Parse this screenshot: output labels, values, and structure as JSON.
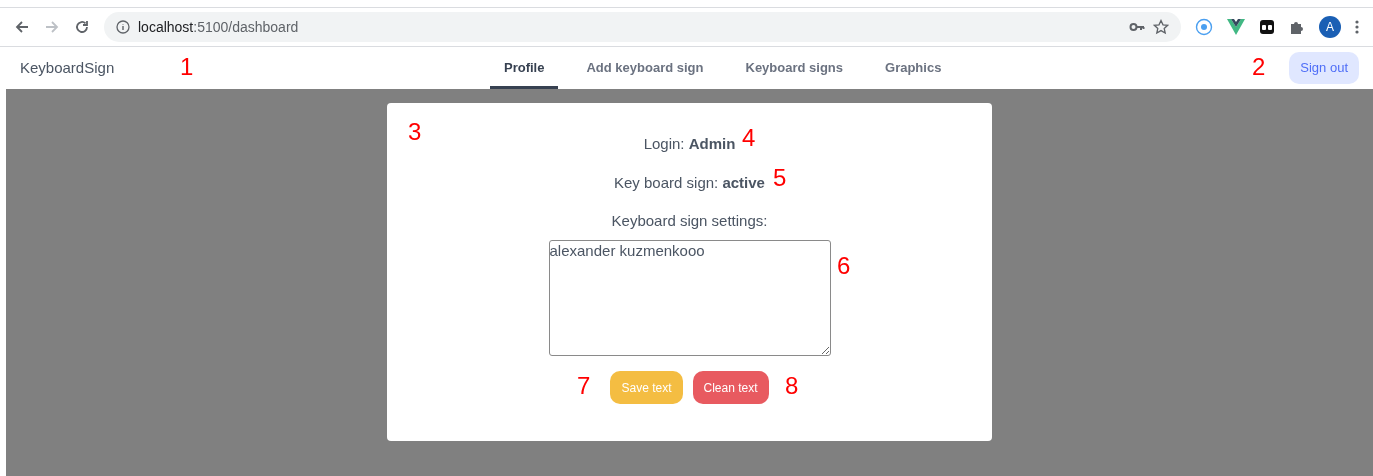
{
  "browser": {
    "url_host": "localhost",
    "url_path": ":5100/dashboard",
    "profile_initial": "A"
  },
  "nav": {
    "brand": "KeyboardSign",
    "tabs": [
      {
        "label": "Profile",
        "selected": true
      },
      {
        "label": "Add keyboard sign",
        "selected": false
      },
      {
        "label": "Keyboard signs",
        "selected": false
      },
      {
        "label": "Graphics",
        "selected": false
      }
    ],
    "sign_out": "Sign out"
  },
  "profile": {
    "login": "Login: **Admin**",
    "sign_status": "Key board sign: **active**",
    "settings_label": "Keyboard sign settings:",
    "settings_value": "alexander kuzmenkooo",
    "buttons": [
      {
        "label": "Save text",
        "kind": "save"
      },
      {
        "label": "Clean text",
        "kind": "clean"
      }
    ]
  },
  "annotations": [
    {
      "label": "1"
    },
    {
      "label": "2"
    },
    {
      "label": "3"
    },
    {
      "label": "4"
    },
    {
      "label": "5"
    },
    {
      "label": "6"
    },
    {
      "label": "7"
    },
    {
      "label": "8"
    }
  ]
}
